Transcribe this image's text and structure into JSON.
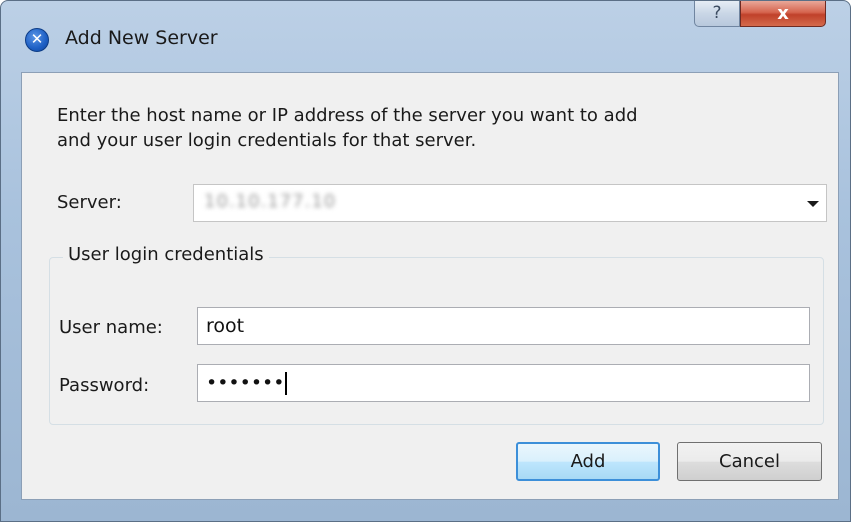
{
  "window": {
    "title": "Add New Server",
    "help_glyph": "?",
    "close_glyph": "x",
    "icon": "app-icon"
  },
  "dialog": {
    "description_line1": "Enter the host name or IP address of the server you want to add",
    "description_line2": "and your user login credentials for that server.",
    "server_label": "Server:",
    "server_value": "10.10.177.10",
    "credentials_group_label": "User login credentials",
    "username_label": "User name:",
    "username_value": "root",
    "password_label": "Password:",
    "password_value": "•••••••",
    "add_button": "Add",
    "cancel_button": "Cancel"
  },
  "colors": {
    "frame": "#a9c2dd",
    "client_bg": "#f0f0f0",
    "default_button_border": "#3c8fd9",
    "close_button": "#c0412a"
  }
}
